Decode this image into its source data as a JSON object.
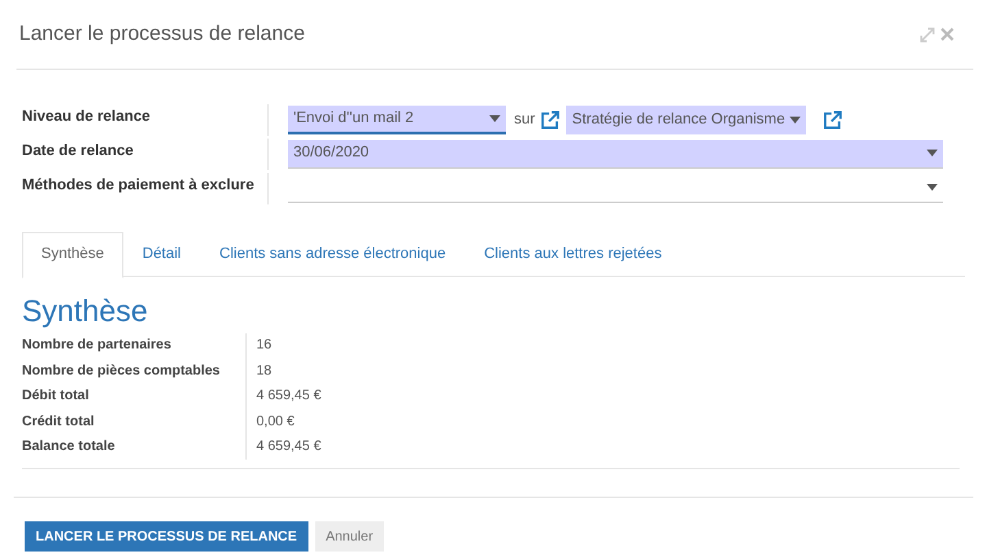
{
  "window": {
    "title": "Lancer le processus de relance"
  },
  "form": {
    "fields": [
      {
        "kind": "level",
        "label": "Niveau de relance",
        "value": "'Envoi d''un mail 2",
        "required": true,
        "focused": true,
        "connector": "sur",
        "strategy": "Stratégie de relance Organisme"
      },
      {
        "kind": "select",
        "label": "Date de relance",
        "value": "30/06/2020",
        "required": true,
        "focused": false
      },
      {
        "kind": "select",
        "label": "Méthodes de paiement à exclure",
        "required": false,
        "focused": false
      }
    ]
  },
  "tabs": [
    {
      "label": "Synthèse",
      "selected": true
    },
    {
      "label": "Détail",
      "selected": false
    },
    {
      "label": "Clients sans adresse électronique",
      "selected": false
    },
    {
      "label": "Clients aux lettres rejetées",
      "selected": false
    }
  ],
  "summary": {
    "heading": "Synthèse",
    "rows": [
      {
        "label": "Nombre de partenaires",
        "value": "16"
      },
      {
        "label": "Nombre de pièces comptables",
        "value": "18"
      },
      {
        "label": "Débit total",
        "value": "4 659,45 €"
      },
      {
        "label": "Crédit total",
        "value": "0,00 €"
      },
      {
        "label": "Balance totale",
        "value": "4 659,45 €"
      }
    ]
  },
  "buttons": [
    {
      "kind": "primary",
      "label": "LANCER LE PROCESSUS DE RELANCE"
    },
    {
      "kind": "secondary",
      "label": "Annuler"
    }
  ]
}
